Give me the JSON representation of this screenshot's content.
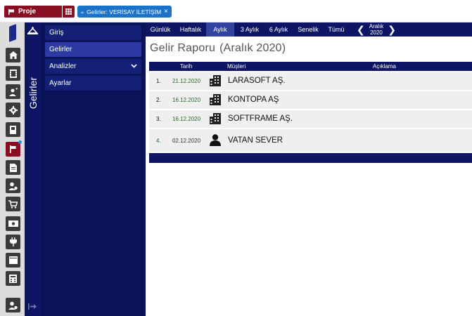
{
  "topbar": {
    "project_label": "Proje",
    "active_tab": "Gelirler: VERİSAY İLETİŞİM",
    "close_glyph": "×"
  },
  "rail": {
    "buttons": [
      {
        "icon": "home-icon"
      },
      {
        "icon": "film-icon"
      },
      {
        "icon": "user-manage-icon"
      },
      {
        "icon": "gear-icon"
      },
      {
        "icon": "book-icon"
      },
      {
        "icon": "flag-icon",
        "active": true
      },
      {
        "icon": "document-icon"
      },
      {
        "icon": "user-settings-icon"
      },
      {
        "icon": "cart-icon"
      },
      {
        "icon": "money-icon"
      },
      {
        "icon": "plug-icon"
      },
      {
        "icon": "monitor-icon"
      },
      {
        "icon": "calculator-icon"
      }
    ],
    "bottom_icon": "user-settings-icon"
  },
  "section_title": "Gelirler",
  "menu": {
    "items": [
      {
        "label": "Giriş"
      },
      {
        "label": "Gelirler"
      },
      {
        "label": "Analizler"
      },
      {
        "label": "Ayarlar"
      }
    ]
  },
  "periods": {
    "items": [
      "Günlük",
      "Haftalık",
      "Aylık",
      "3 Aylık",
      "6 Aylık",
      "Senelik",
      "Tümü"
    ],
    "active": "Aylık",
    "month": "Aralık",
    "year": "2020"
  },
  "report": {
    "title": "Gelir Raporu",
    "period": "(Aralık 2020)"
  },
  "table": {
    "headers": {
      "date": "Tarih",
      "customer": "Müşteri",
      "description": "Açıklama"
    },
    "rows": [
      {
        "no": "1.",
        "date": "21.12.2020",
        "type": "company",
        "customer": "LARASOFT AŞ."
      },
      {
        "no": "2.",
        "date": "16.12.2020",
        "type": "company",
        "customer": "KONTOPA AŞ"
      },
      {
        "no": "3.",
        "date": "16.12.2020",
        "type": "company",
        "customer": "SOFTFRAME AŞ."
      },
      {
        "no": "4.",
        "date": "02.12.2020",
        "type": "person",
        "customer": "VATAN SEVER"
      }
    ]
  },
  "colors": {
    "navy": "#0d1564",
    "menu_bg": "#0a1358",
    "accent_red": "#8a0e22",
    "tab_blue": "#1a73c9"
  }
}
